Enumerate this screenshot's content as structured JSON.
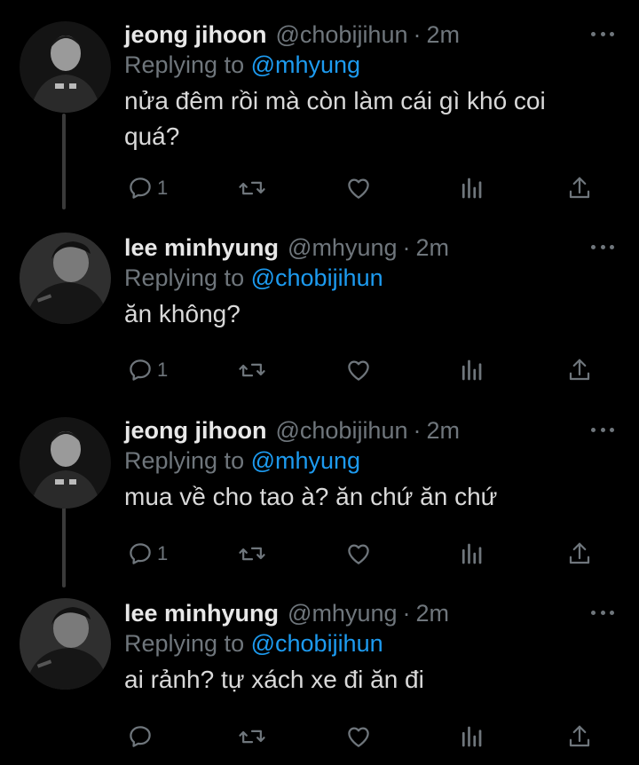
{
  "colors": {
    "background": "#000000",
    "mention": "#1d9bf0",
    "muted": "#6f767c",
    "text": "#d9d9d9"
  },
  "tweets": [
    {
      "name": "jeong jihoon",
      "handle": "@chobijihun",
      "separator": "·",
      "time": "2m",
      "replying_prefix": "Replying to",
      "replying_to": "@mhyung",
      "text": "nửa đêm rồi mà còn làm cái gì khó coi quá?",
      "reply_count": "1",
      "icons": [
        "reply-icon",
        "retweet-icon",
        "like-icon",
        "views-icon",
        "share-icon",
        "more-icon"
      ]
    },
    {
      "name": "lee minhyung",
      "handle": "@mhyung",
      "separator": "·",
      "time": "2m",
      "replying_prefix": "Replying to",
      "replying_to": "@chobijihun",
      "text": "ăn không?",
      "reply_count": "1",
      "icons": [
        "reply-icon",
        "retweet-icon",
        "like-icon",
        "views-icon",
        "share-icon",
        "more-icon"
      ]
    },
    {
      "name": "jeong jihoon",
      "handle": "@chobijihun",
      "separator": "·",
      "time": "2m",
      "replying_prefix": "Replying to",
      "replying_to": "@mhyung",
      "text": "mua về cho tao à? ăn chứ ăn chứ",
      "reply_count": "1",
      "icons": [
        "reply-icon",
        "retweet-icon",
        "like-icon",
        "views-icon",
        "share-icon",
        "more-icon"
      ]
    },
    {
      "name": "lee minhyung",
      "handle": "@mhyung",
      "separator": "·",
      "time": "2m",
      "replying_prefix": "Replying to",
      "replying_to": "@chobijihun",
      "text": "ai rảnh? tự xách xe đi ăn đi",
      "reply_count": "",
      "icons": [
        "reply-icon",
        "retweet-icon",
        "like-icon",
        "views-icon",
        "share-icon",
        "more-icon"
      ]
    }
  ]
}
